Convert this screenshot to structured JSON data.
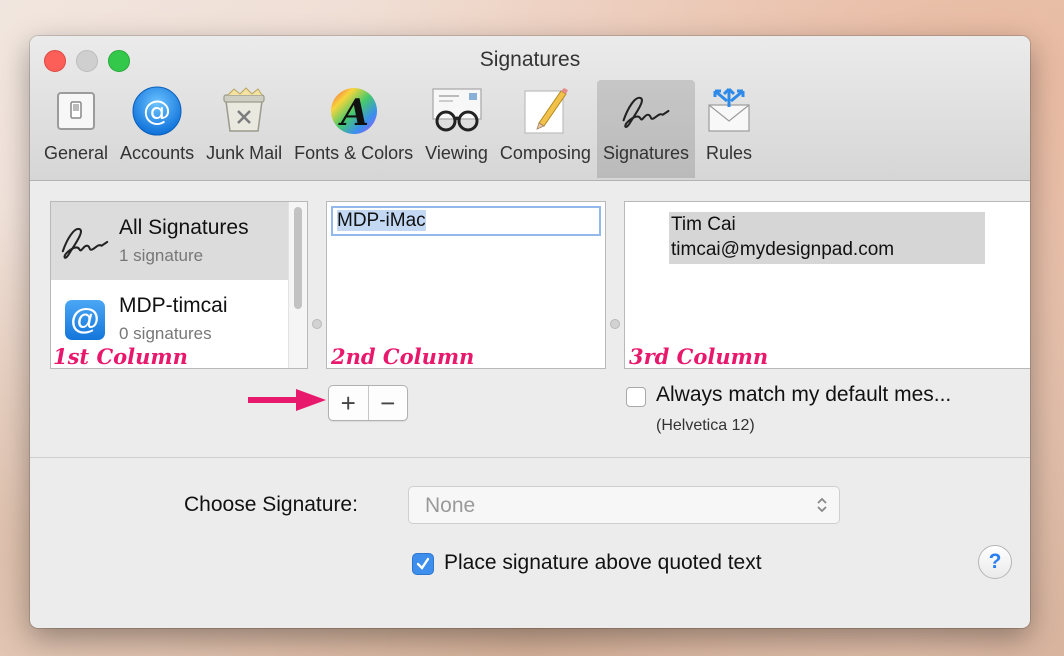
{
  "window": {
    "title": "Signatures"
  },
  "toolbar": {
    "items": [
      {
        "label": "General",
        "icon": "general-switch-icon"
      },
      {
        "label": "Accounts",
        "icon": "at-icon"
      },
      {
        "label": "Junk Mail",
        "icon": "junk-trash-icon"
      },
      {
        "label": "Fonts & Colors",
        "icon": "fonts-colors-icon"
      },
      {
        "label": "Viewing",
        "icon": "glasses-icon"
      },
      {
        "label": "Composing",
        "icon": "pencil-paper-icon"
      },
      {
        "label": "Signatures",
        "icon": "signature-icon",
        "active": true
      },
      {
        "label": "Rules",
        "icon": "rules-envelope-icon"
      }
    ]
  },
  "accounts_list": {
    "items": [
      {
        "name": "All Signatures",
        "count": "1 signature",
        "selected": true
      },
      {
        "name": "MDP-timcai",
        "count": "0 signatures",
        "selected": false
      }
    ]
  },
  "signatures_list": {
    "items": [
      {
        "name": "MDP-iMac"
      }
    ]
  },
  "preview": {
    "line1": "Tim Cai",
    "line2": "timcai@mydesignpad.com"
  },
  "annotations": {
    "col1": "1st Column",
    "col2": "2nd Column",
    "col3": "3rd Column"
  },
  "buttons": {
    "add": "+",
    "remove": "−"
  },
  "match_default": {
    "label": "Always match my default mes...",
    "font": "(Helvetica 12)",
    "checked": false
  },
  "choose_signature": {
    "label": "Choose Signature:",
    "value": "None"
  },
  "place_above": {
    "label": "Place signature above quoted text",
    "checked": true
  },
  "help": {
    "label": "?"
  },
  "colors": {
    "annotation": "#e8186d",
    "accent": "#3d8eed",
    "selection": "#dcdcdc"
  }
}
